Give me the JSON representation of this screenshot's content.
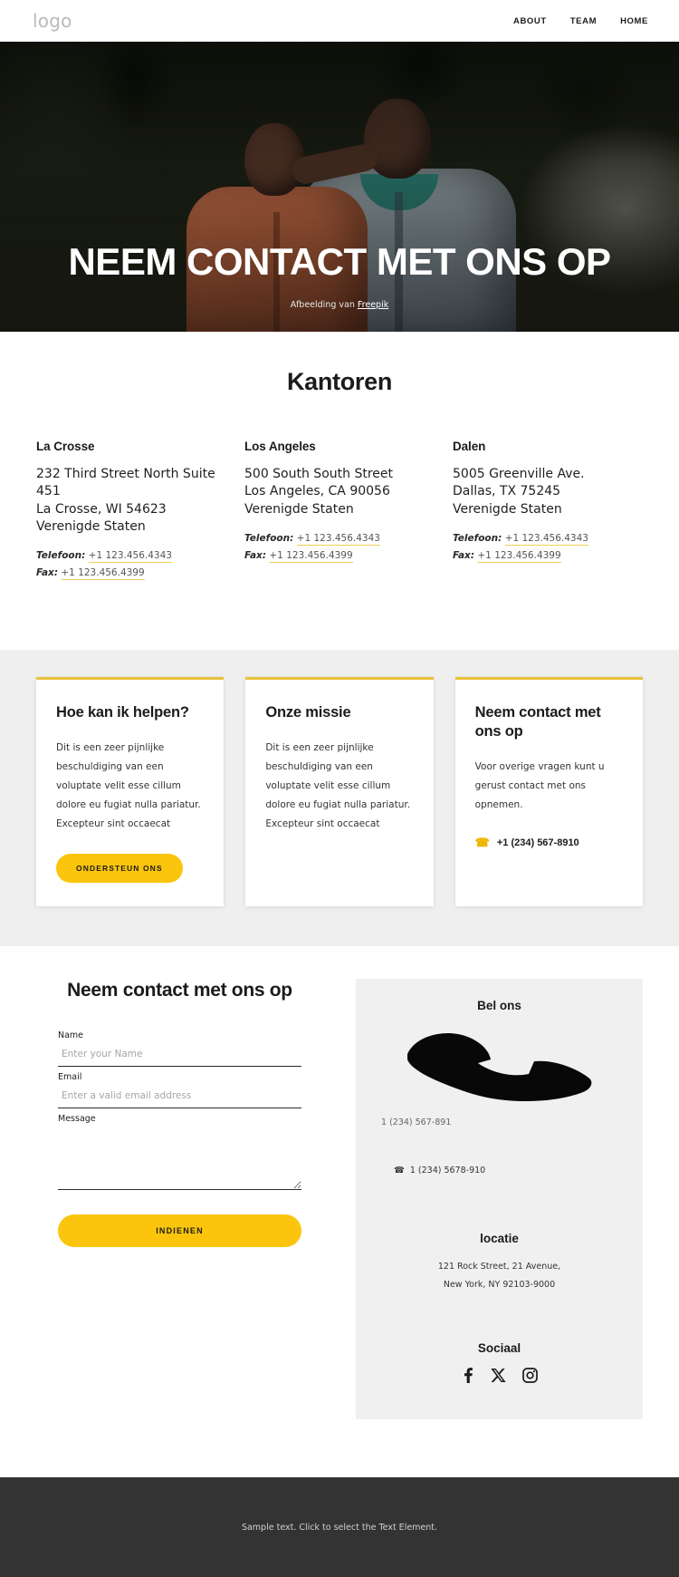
{
  "header": {
    "logo": "logo",
    "nav": [
      {
        "label": "ABOUT"
      },
      {
        "label": "TEAM"
      },
      {
        "label": "HOME"
      }
    ]
  },
  "hero": {
    "title": "NEEM CONTACT MET ONS OP",
    "credit_prefix": "Afbeelding van ",
    "credit_link": "Freepik"
  },
  "offices": {
    "title": "Kantoren",
    "phone_label": "Telefoon:",
    "fax_label": "Fax:",
    "items": [
      {
        "name": "La Crosse",
        "address": "232 Third Street North Suite 451\nLa Crosse, WI 54623\nVerenigde Staten",
        "phone": "+1 123.456.4343",
        "fax": "+1 123.456.4399"
      },
      {
        "name": "Los Angeles",
        "address": "500 South South Street\nLos Angeles, CA 90056\nVerenigde Staten",
        "phone": "+1 123.456.4343",
        "fax": "+1 123.456.4399"
      },
      {
        "name": "Dalen",
        "address": "5005 Greenville Ave.\nDallas, TX 75245\nVerenigde Staten",
        "phone": "+1 123.456.4343",
        "fax": "+1 123.456.4399"
      }
    ]
  },
  "cards": [
    {
      "title": "Hoe kan ik helpen?",
      "text": "Dit is een zeer pijnlijke beschuldiging van een voluptate velit esse cillum dolore eu fugiat nulla pariatur. Excepteur sint occaecat",
      "button": "ONDERSTEUN ONS"
    },
    {
      "title": "Onze missie",
      "text": "Dit is een zeer pijnlijke beschuldiging van een voluptate velit esse cillum dolore eu fugiat nulla pariatur. Excepteur sint occaecat"
    },
    {
      "title": "Neem contact met ons op",
      "text": "Voor overige vragen kunt u gerust contact met ons opnemen.",
      "phone": "+1 (234) 567-8910"
    }
  ],
  "contact_form": {
    "title": "Neem contact met ons op",
    "name_label": "Name",
    "name_placeholder": "Enter your Name",
    "email_label": "Email",
    "email_placeholder": "Enter a valid email address",
    "message_label": "Message",
    "message_placeholder": "",
    "submit_label": "INDIENEN"
  },
  "info_panel": {
    "call_title": "Bel ons",
    "phone_primary": "1 (234) 567-891",
    "phone_secondary": "1 (234) 5678-910",
    "location_title": "locatie",
    "location_address": "121 Rock Street, 21 Avenue,\nNew York, NY 92103-9000",
    "social_title": "Sociaal",
    "socials": [
      {
        "name": "facebook-icon"
      },
      {
        "name": "x-twitter-icon"
      },
      {
        "name": "instagram-icon"
      }
    ]
  },
  "footer": {
    "text": "Sample text. Click to select the Text Element."
  },
  "colors": {
    "accent_yellow": "#fbc50d",
    "card_border": "#e8c13b",
    "link_underline": "#f0cf5a",
    "footer_bg": "#333333",
    "section_bg": "#efefef"
  }
}
